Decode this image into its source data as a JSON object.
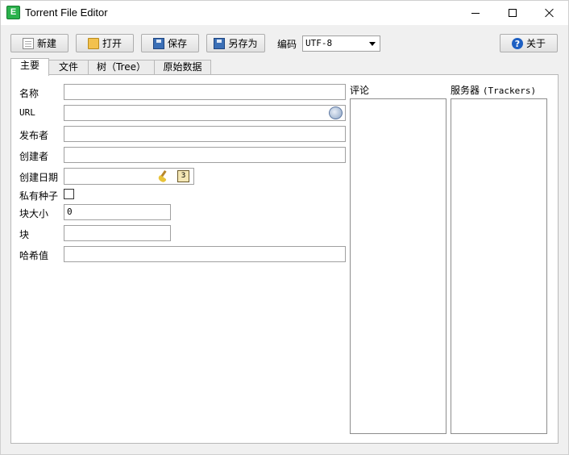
{
  "window": {
    "title": "Torrent File Editor",
    "icon": "app-icon"
  },
  "toolbar": {
    "new_label": "新建",
    "open_label": "打开",
    "save_label": "保存",
    "save_as_label": "另存为",
    "encoding_label": "编码",
    "encoding_value": "UTF-8",
    "about_label": "关于"
  },
  "tabs": [
    {
      "label": "主要"
    },
    {
      "label": "文件"
    },
    {
      "label": "树（Tree）"
    },
    {
      "label": "原始数据"
    }
  ],
  "form": {
    "name_label": "名称",
    "name_value": "",
    "url_label": "URL",
    "url_value": "",
    "publisher_label": "发布者",
    "publisher_value": "",
    "creator_label": "创建者",
    "creator_value": "",
    "created_date_label": "创建日期",
    "created_date_value": "",
    "calendar_day": "3",
    "private_label": "私有种子",
    "private_checked": false,
    "piece_size_label": "块大小",
    "piece_size_value": "0",
    "pieces_label": "块",
    "pieces_value": "",
    "hash_label": "哈希值",
    "hash_value": ""
  },
  "comment": {
    "label": "评论"
  },
  "trackers": {
    "label_prefix": "服务器",
    "label_suffix": "(Trackers)"
  },
  "colors": {
    "window_bg": "#f0f0f0",
    "panel_bg": "#ffffff",
    "border": "#a0a0a0",
    "app_icon_green": "#2bb24c"
  }
}
